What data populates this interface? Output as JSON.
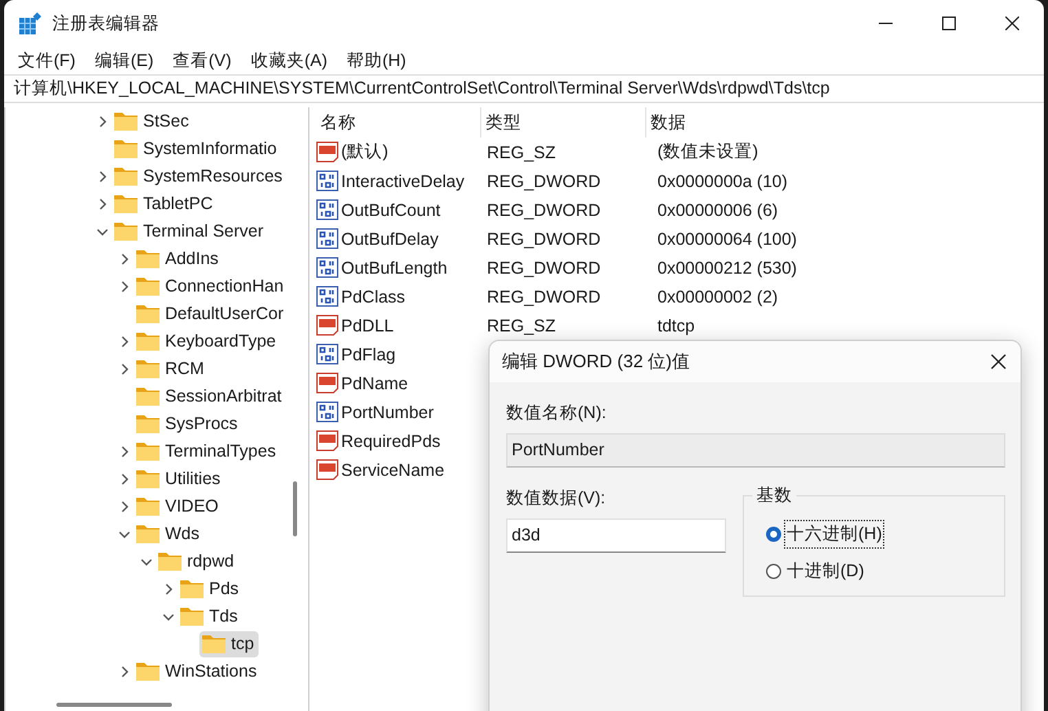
{
  "window": {
    "title": "注册表编辑器"
  },
  "menu": [
    "文件(F)",
    "编辑(E)",
    "查看(V)",
    "收藏夹(A)",
    "帮助(H)"
  ],
  "address": "计算机\\HKEY_LOCAL_MACHINE\\SYSTEM\\CurrentControlSet\\Control\\Terminal Server\\Wds\\rdpwd\\Tds\\tcp",
  "tree": {
    "items": [
      {
        "label": "StSec",
        "expanded": false,
        "selected": false
      },
      {
        "label": "SystemInformatio",
        "selected": false
      },
      {
        "label": "SystemResources",
        "expanded": false,
        "selected": false
      },
      {
        "label": "TabletPC",
        "expanded": false,
        "selected": false
      },
      {
        "label": "Terminal Server",
        "expanded": true,
        "selected": false,
        "children": [
          {
            "label": "AddIns",
            "expanded": false,
            "selected": false
          },
          {
            "label": "ConnectionHan",
            "expanded": false,
            "selected": false
          },
          {
            "label": "DefaultUserCor",
            "selected": false
          },
          {
            "label": "KeyboardType",
            "expanded": false,
            "selected": false
          },
          {
            "label": "RCM",
            "expanded": false,
            "selected": false
          },
          {
            "label": "SessionArbitrat",
            "selected": false
          },
          {
            "label": "SysProcs",
            "selected": false
          },
          {
            "label": "TerminalTypes",
            "expanded": false,
            "selected": false
          },
          {
            "label": "Utilities",
            "expanded": false,
            "selected": false
          },
          {
            "label": "VIDEO",
            "expanded": false,
            "selected": false
          },
          {
            "label": "Wds",
            "expanded": true,
            "selected": false,
            "children": [
              {
                "label": "rdpwd",
                "expanded": true,
                "selected": false,
                "children": [
                  {
                    "label": "Pds",
                    "expanded": false,
                    "selected": false
                  },
                  {
                    "label": "Tds",
                    "expanded": true,
                    "selected": false,
                    "children": [
                      {
                        "label": "tcp",
                        "selected": true
                      }
                    ]
                  }
                ]
              }
            ]
          },
          {
            "label": "WinStations",
            "expanded": false,
            "selected": false
          }
        ]
      }
    ]
  },
  "table": {
    "columns": [
      "名称",
      "类型",
      "数据"
    ],
    "rows": [
      {
        "kind": "string",
        "name": "(默认)",
        "type": "REG_SZ",
        "data": "(数值未设置)"
      },
      {
        "kind": "binary",
        "name": "InteractiveDelay",
        "type": "REG_DWORD",
        "data": "0x0000000a (10)"
      },
      {
        "kind": "binary",
        "name": "OutBufCount",
        "type": "REG_DWORD",
        "data": "0x00000006 (6)"
      },
      {
        "kind": "binary",
        "name": "OutBufDelay",
        "type": "REG_DWORD",
        "data": "0x00000064 (100)"
      },
      {
        "kind": "binary",
        "name": "OutBufLength",
        "type": "REG_DWORD",
        "data": "0x00000212 (530)"
      },
      {
        "kind": "binary",
        "name": "PdClass",
        "type": "REG_DWORD",
        "data": "0x00000002 (2)"
      },
      {
        "kind": "string",
        "name": "PdDLL",
        "type": "REG_SZ",
        "data": "tdtcp"
      },
      {
        "kind": "binary",
        "name": "PdFlag"
      },
      {
        "kind": "string",
        "name": "PdName"
      },
      {
        "kind": "binary",
        "name": "PortNumber"
      },
      {
        "kind": "string",
        "name": "RequiredPds"
      },
      {
        "kind": "string",
        "name": "ServiceName"
      }
    ]
  },
  "dialog": {
    "title": "编辑 DWORD (32 位)值",
    "name_label": "数值名称(N):",
    "name_value": "PortNumber",
    "data_label": "数值数据(V):",
    "data_value": "d3d",
    "base_label": "基数",
    "bases": [
      {
        "label": "十六进制(H)",
        "selected": true
      },
      {
        "label": "十进制(D)",
        "selected": false
      }
    ]
  }
}
